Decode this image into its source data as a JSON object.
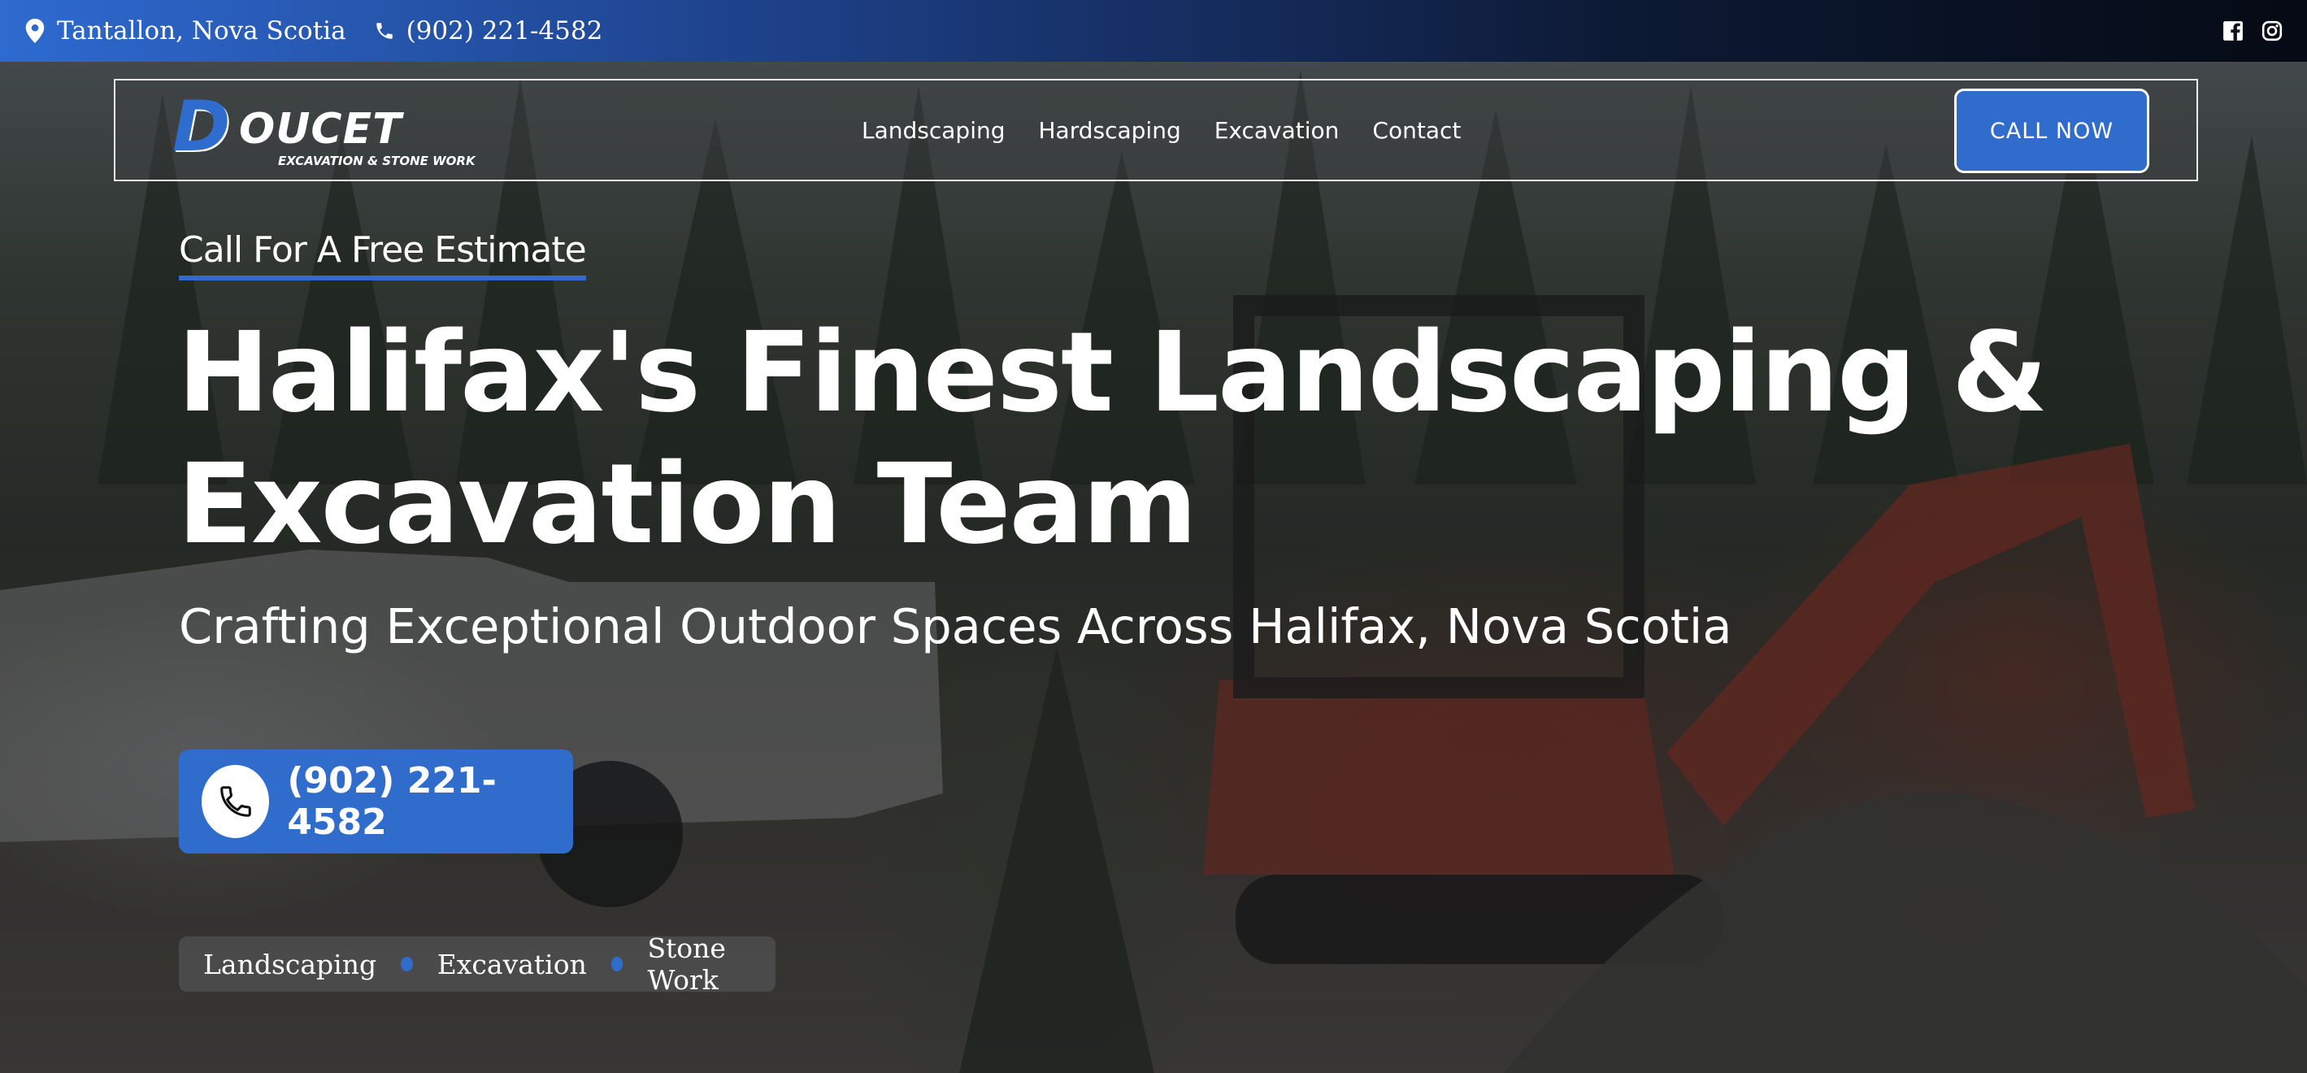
{
  "topbar": {
    "location": "Tantallon, Nova Scotia",
    "phone": "(902) 221-4582",
    "location_icon": "map-pin-icon",
    "phone_icon": "phone-icon",
    "social": [
      "facebook-icon",
      "instagram-icon"
    ]
  },
  "logo": {
    "mark": "D",
    "wordmark": "OUCET",
    "tagline": "EXCAVATION & STONE WORK"
  },
  "nav": {
    "items": [
      "Landscaping",
      "Hardscaping",
      "Excavation",
      "Contact"
    ],
    "cta": "CALL NOW"
  },
  "hero": {
    "eyebrow": "Call For A Free Estimate",
    "headline_line1": "Halifax's Finest Landscaping &",
    "headline_line2": "Excavation Team",
    "subheadline": "Crafting Exceptional Outdoor Spaces Across Halifax, Nova Scotia",
    "phone_button": "(902) 221-4582",
    "tags": [
      "Landscaping",
      "Excavation",
      "Stone Work"
    ]
  },
  "colors": {
    "brand_blue": "#2f6ccc",
    "text": "#ffffff"
  }
}
